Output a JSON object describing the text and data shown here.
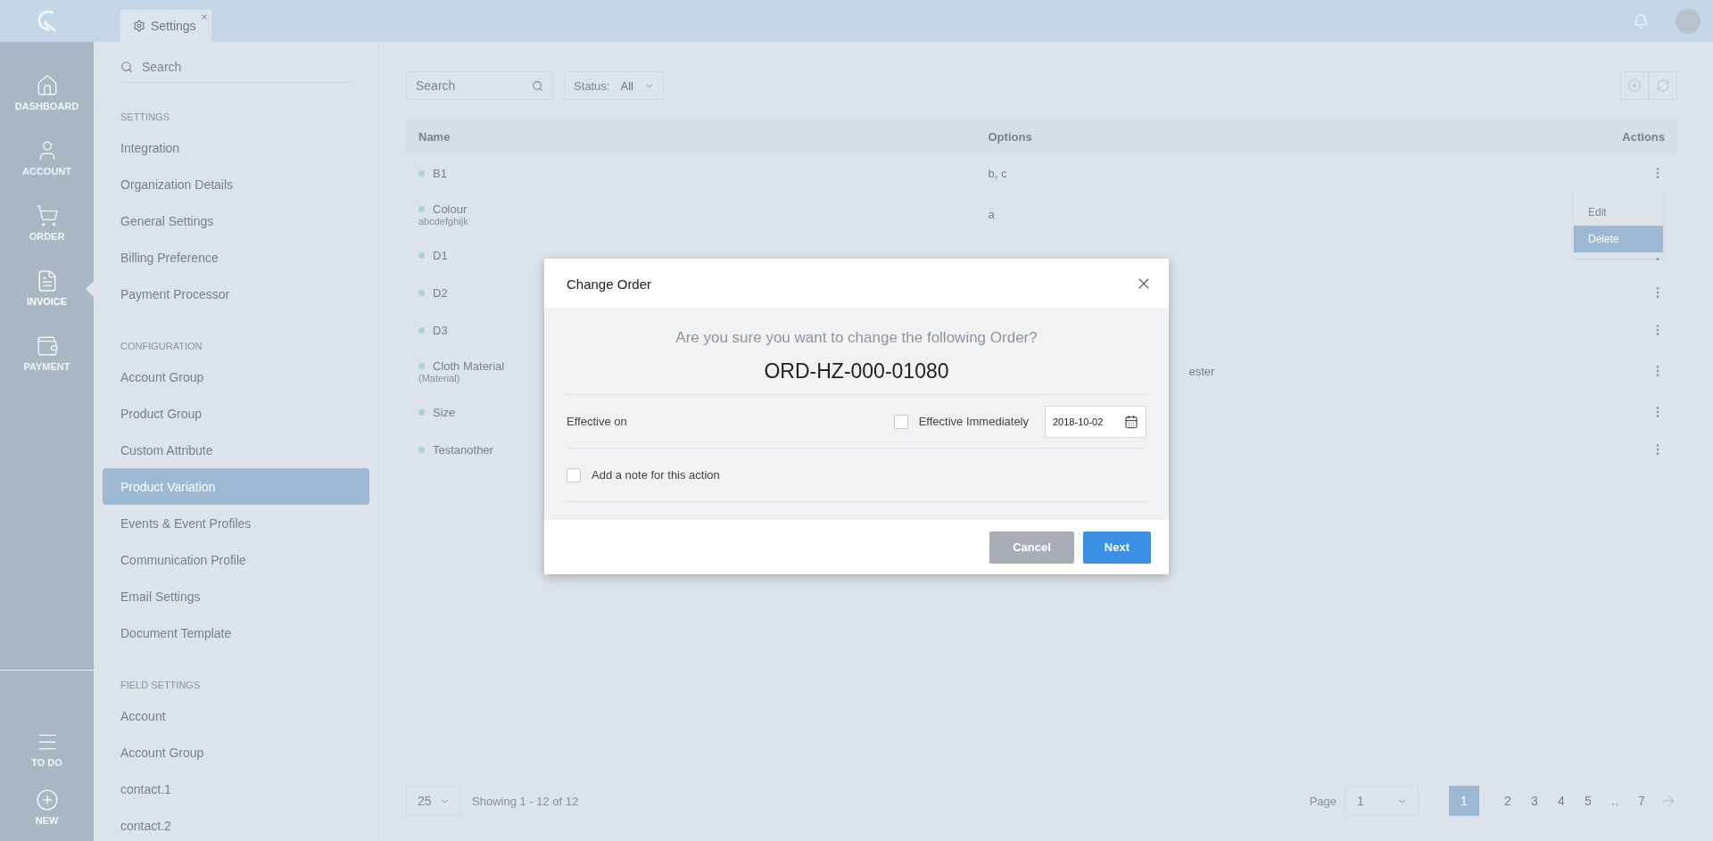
{
  "top_bar": {
    "tab": {
      "label": "Settings"
    }
  },
  "nav": [
    {
      "label": "DASHBOARD",
      "selected": false
    },
    {
      "label": "ACCOUNT",
      "selected": false
    },
    {
      "label": "ORDER",
      "selected": false
    },
    {
      "label": "INVOICE",
      "selected": true
    },
    {
      "label": "PAYMENT",
      "selected": false
    }
  ],
  "nav_bottom": [
    {
      "label": "TO DO"
    },
    {
      "label": "NEW"
    }
  ],
  "sidebar": {
    "search_placeholder": "Search",
    "sections": [
      {
        "title": "SETTINGS",
        "items": [
          {
            "label": "Integration",
            "selected": false
          },
          {
            "label": "Organization Details",
            "selected": false
          },
          {
            "label": "General Settings",
            "selected": false
          },
          {
            "label": "Billing Preference",
            "selected": false
          },
          {
            "label": "Payment Processor",
            "selected": false
          }
        ]
      },
      {
        "title": "CONFIGURATION",
        "items": [
          {
            "label": "Account Group",
            "selected": false
          },
          {
            "label": "Product Group",
            "selected": false
          },
          {
            "label": "Custom Attribute",
            "selected": false
          },
          {
            "label": "Product Variation",
            "selected": true
          },
          {
            "label": "Events & Event Profiles",
            "selected": false
          },
          {
            "label": "Communication Profile",
            "selected": false
          },
          {
            "label": "Email Settings",
            "selected": false
          },
          {
            "label": "Document Template",
            "selected": false
          }
        ]
      },
      {
        "title": "FIELD SETTINGS",
        "items": [
          {
            "label": "Account",
            "selected": false
          },
          {
            "label": "Account Group",
            "selected": false
          },
          {
            "label": "contact.1",
            "selected": false
          },
          {
            "label": "contact.2",
            "selected": false
          }
        ]
      }
    ]
  },
  "toolbar": {
    "search_placeholder": "Search",
    "status_label": "Status:",
    "status_value": "All"
  },
  "table": {
    "columns": [
      "Name",
      "Options",
      "Actions"
    ],
    "rows": [
      {
        "name": "B1",
        "options": "b, c"
      },
      {
        "name": "Colour",
        "subtitle": "abcdefghijk",
        "options": "a"
      },
      {
        "name": "D1"
      },
      {
        "name": "D2"
      },
      {
        "name": "D3"
      },
      {
        "name": "Cloth Material",
        "subtitle": "(Material)",
        "options_tail": "ester"
      },
      {
        "name": "Size"
      },
      {
        "name": "Testanother"
      }
    ]
  },
  "row_menu": {
    "items": [
      {
        "label": "Edit",
        "selected": false
      },
      {
        "label": "Delete",
        "selected": true
      }
    ]
  },
  "footer": {
    "page_size": "25",
    "showing": "Showing 1 - 12 of 12",
    "page_label": "Page",
    "page_value": "1",
    "pages": [
      {
        "label": "1",
        "selected": true
      },
      {
        "label": "2",
        "selected": false
      },
      {
        "label": "3",
        "selected": false
      },
      {
        "label": "4",
        "selected": false
      },
      {
        "label": "5",
        "selected": false
      },
      {
        "label": "..",
        "selected": false
      },
      {
        "label": "7",
        "selected": false
      }
    ]
  },
  "dialog": {
    "title": "Change Order",
    "question": "Are you sure you want to change the following Order?",
    "order_number": "ORD-HZ-000-01080",
    "effective_label": "Effective on",
    "immediately": {
      "label": "Effective Immediately",
      "checked": false
    },
    "date": "2018-10-02",
    "note": {
      "label": "Add a note for this action",
      "checked": false
    },
    "buttons": [
      {
        "label": "Cancel",
        "kind": "secondary"
      },
      {
        "label": "Next",
        "kind": "primary"
      }
    ]
  }
}
